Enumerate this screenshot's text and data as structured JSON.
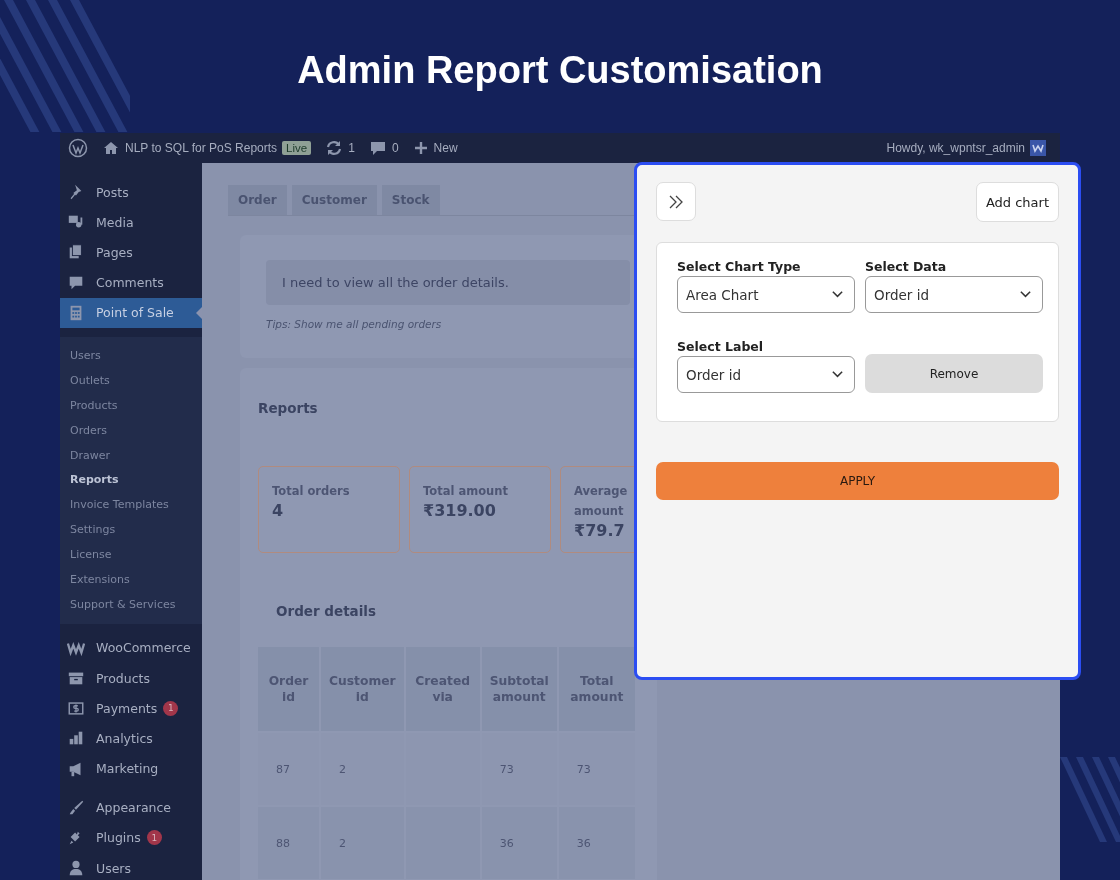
{
  "heading": "Admin Report Customisation",
  "admin_bar": {
    "site_name": "NLP to SQL for PoS Reports",
    "live_badge": "Live",
    "updates_count": "1",
    "comments_count": "0",
    "new_label": "New",
    "greeting": "Howdy, wk_wpntsr_admin"
  },
  "sidebar": {
    "groups": [
      [
        {
          "label": "Posts",
          "selected": false
        },
        {
          "label": "Media",
          "selected": false
        },
        {
          "label": "Pages",
          "selected": false
        },
        {
          "label": "Comments",
          "selected": false
        },
        {
          "label": "Point of Sale",
          "selected": true,
          "children": [
            {
              "label": "Users",
              "selected": false
            },
            {
              "label": "Outlets",
              "selected": false
            },
            {
              "label": "Products",
              "selected": false
            },
            {
              "label": "Orders",
              "selected": false
            },
            {
              "label": "Drawer",
              "selected": false
            },
            {
              "label": "Reports",
              "selected": true
            },
            {
              "label": "Invoice Templates",
              "selected": false
            },
            {
              "label": "Settings",
              "selected": false
            },
            {
              "label": "License",
              "selected": false
            },
            {
              "label": "Extensions",
              "selected": false
            },
            {
              "label": "Support & Services",
              "selected": false
            }
          ]
        }
      ],
      [
        {
          "label": "WooCommerce",
          "selected": false
        },
        {
          "label": "Products",
          "selected": false
        },
        {
          "label": "Payments",
          "selected": false,
          "badge": "1"
        },
        {
          "label": "Analytics",
          "selected": false
        },
        {
          "label": "Marketing",
          "selected": false
        }
      ],
      [
        {
          "label": "Appearance",
          "selected": false
        },
        {
          "label": "Plugins",
          "selected": false,
          "badge": "1"
        },
        {
          "label": "Users",
          "selected": false
        }
      ]
    ]
  },
  "tabs": [
    {
      "label": "Order",
      "selected": false
    },
    {
      "label": "Customer",
      "selected": false
    },
    {
      "label": "Stock",
      "selected": false
    }
  ],
  "query": {
    "value": "I need to view all the order details.",
    "tip": "Tips: Show me all pending orders"
  },
  "reports": {
    "title": "Reports",
    "stats": [
      {
        "label": "Total orders",
        "value": "4"
      },
      {
        "label": "Total amount",
        "value": "₹319.00"
      },
      {
        "label": "Average amount",
        "value": "₹79.7"
      }
    ]
  },
  "order_details": {
    "title": "Order details",
    "table": {
      "columns": [
        {
          "label": "Order id",
          "values": [
            "87",
            "88"
          ]
        },
        {
          "label": "Customer id",
          "values": [
            "2",
            "2"
          ]
        },
        {
          "label": "Created via"
        },
        {
          "label": "Subtotal amount",
          "values": [
            "73",
            "36"
          ]
        },
        {
          "label": "Total amount",
          "values": [
            "73",
            "36"
          ]
        }
      ]
    }
  },
  "chart_panel": {
    "add_chart_button": "Add chart",
    "selects": [
      {
        "label": "Select Chart Type",
        "value": "Area Chart"
      },
      {
        "label": "Select Data",
        "value": "Order id"
      },
      {
        "label": "Select Label",
        "value": "Order id"
      }
    ],
    "remove_button": "Remove",
    "apply_button": "APPLY"
  }
}
